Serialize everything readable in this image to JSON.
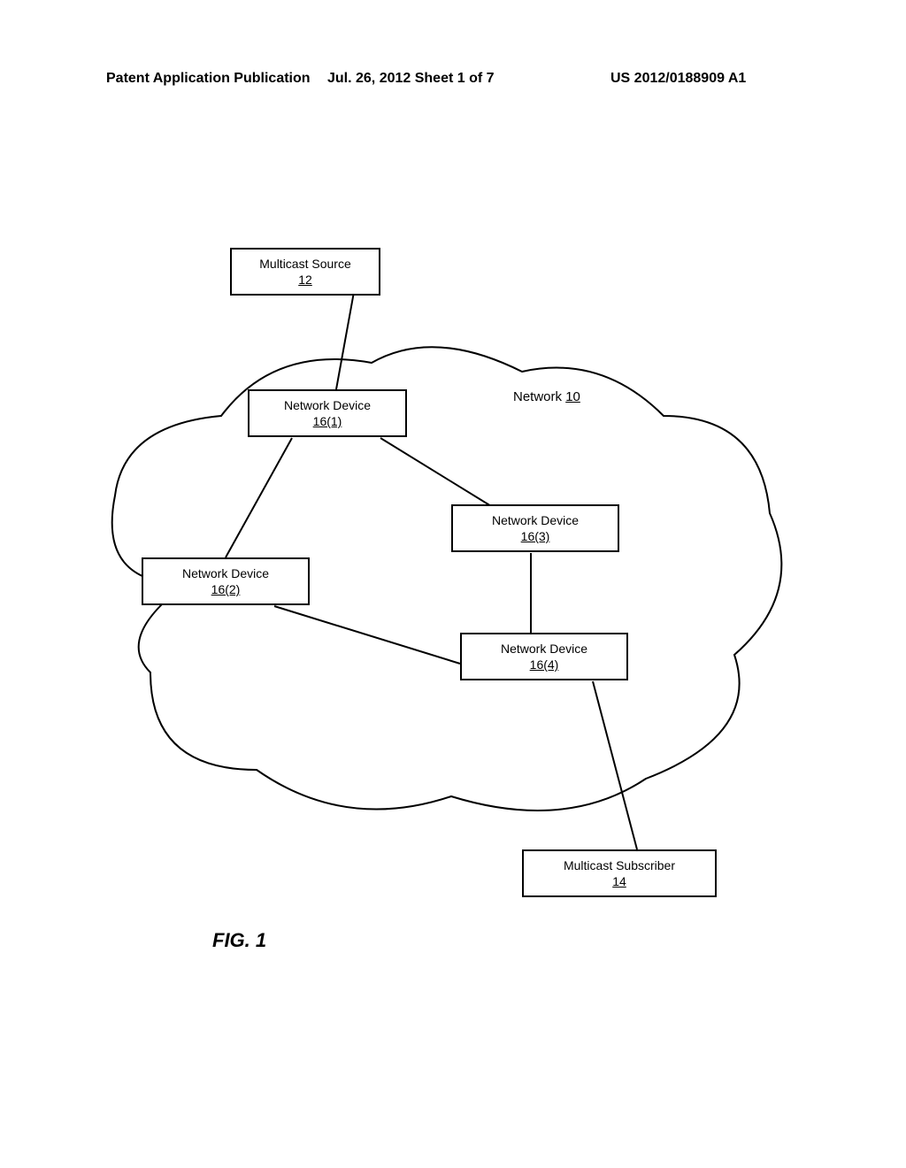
{
  "header": {
    "left": "Patent Application Publication",
    "center": "Jul. 26, 2012  Sheet 1 of 7",
    "right": "US 2012/0188909 A1"
  },
  "network_label": "Network ",
  "network_ref": "10",
  "boxes": {
    "multicast_source": {
      "label": "Multicast Source",
      "ref": "12"
    },
    "network_device_1": {
      "label": "Network Device",
      "ref": "16(1)"
    },
    "network_device_2": {
      "label": "Network Device",
      "ref": "16(2)"
    },
    "network_device_3": {
      "label": "Network Device",
      "ref": "16(3)"
    },
    "network_device_4": {
      "label": "Network Device",
      "ref": "16(4)"
    },
    "multicast_subscriber": {
      "label": "Multicast Subscriber",
      "ref": "14"
    }
  },
  "figure_label": "FIG. 1"
}
